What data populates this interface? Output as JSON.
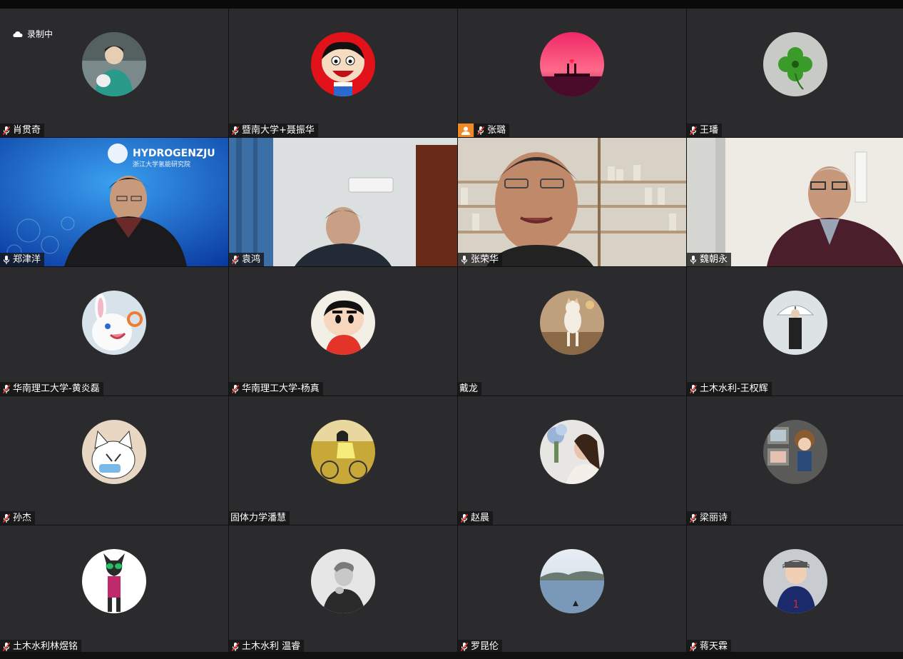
{
  "recording": {
    "label": "录制中"
  },
  "participants": [
    {
      "name": "肖贯奇",
      "avatar": "photo-person-green-hoodie-icon",
      "mic": "muted"
    },
    {
      "name": "暨南大学+聂振华",
      "avatar": "wangzai-mascot-icon",
      "mic": "muted"
    },
    {
      "name": "张璐",
      "avatar": "sunset-pier-icon",
      "mic": "muted",
      "host": true
    },
    {
      "name": "王璠",
      "avatar": "four-leaf-clover-icon",
      "mic": "muted"
    },
    {
      "name": "郑津洋",
      "video": "hydrogenzju-speaker-video",
      "mic": "on"
    },
    {
      "name": "袁鸿",
      "video": "room-speaker-video",
      "mic": "muted"
    },
    {
      "name": "张荣华",
      "video": "bookshelf-speaker-video",
      "mic": "on",
      "speaking": true
    },
    {
      "name": "魏朝永",
      "video": "window-speaker-video",
      "mic": "on"
    },
    {
      "name": "华南理工大学-黄炎磊",
      "avatar": "white-rabbit-cartoon-icon",
      "mic": "muted"
    },
    {
      "name": "华南理工大学-杨真",
      "avatar": "crayon-shinchan-icon",
      "mic": "muted"
    },
    {
      "name": "戴龙",
      "avatar": "dancing-cat-icon",
      "mic": "none"
    },
    {
      "name": "土木水利-王权辉",
      "avatar": "umbrella-person-icon",
      "mic": "muted"
    },
    {
      "name": "孙杰",
      "avatar": "cartoon-cat-icon",
      "mic": "muted"
    },
    {
      "name": "固体力学潘慧",
      "avatar": "girl-bicycle-icon",
      "mic": "none"
    },
    {
      "name": "赵晨",
      "avatar": "woman-flowers-icon",
      "mic": "muted"
    },
    {
      "name": "梁丽诗",
      "avatar": "doll-tv-icon",
      "mic": "muted"
    },
    {
      "name": "土木水利林煜铭",
      "avatar": "masked-rider-icon",
      "mic": "muted"
    },
    {
      "name": "土木水利 温睿",
      "avatar": "bw-man-portrait-icon",
      "mic": "muted"
    },
    {
      "name": "罗昆伦",
      "avatar": "lake-scenery-icon",
      "mic": "muted"
    },
    {
      "name": "蒋天霖",
      "avatar": "child-basketball-icon",
      "mic": "muted"
    }
  ],
  "video_text": {
    "logo": "HYDROGENZJU",
    "logo_sub": "浙江大学氢能研究院"
  },
  "colors": {
    "tile_bg": "#2b2b2d",
    "host_badge": "#f08a24",
    "speaking_border": "#2bd26b"
  }
}
